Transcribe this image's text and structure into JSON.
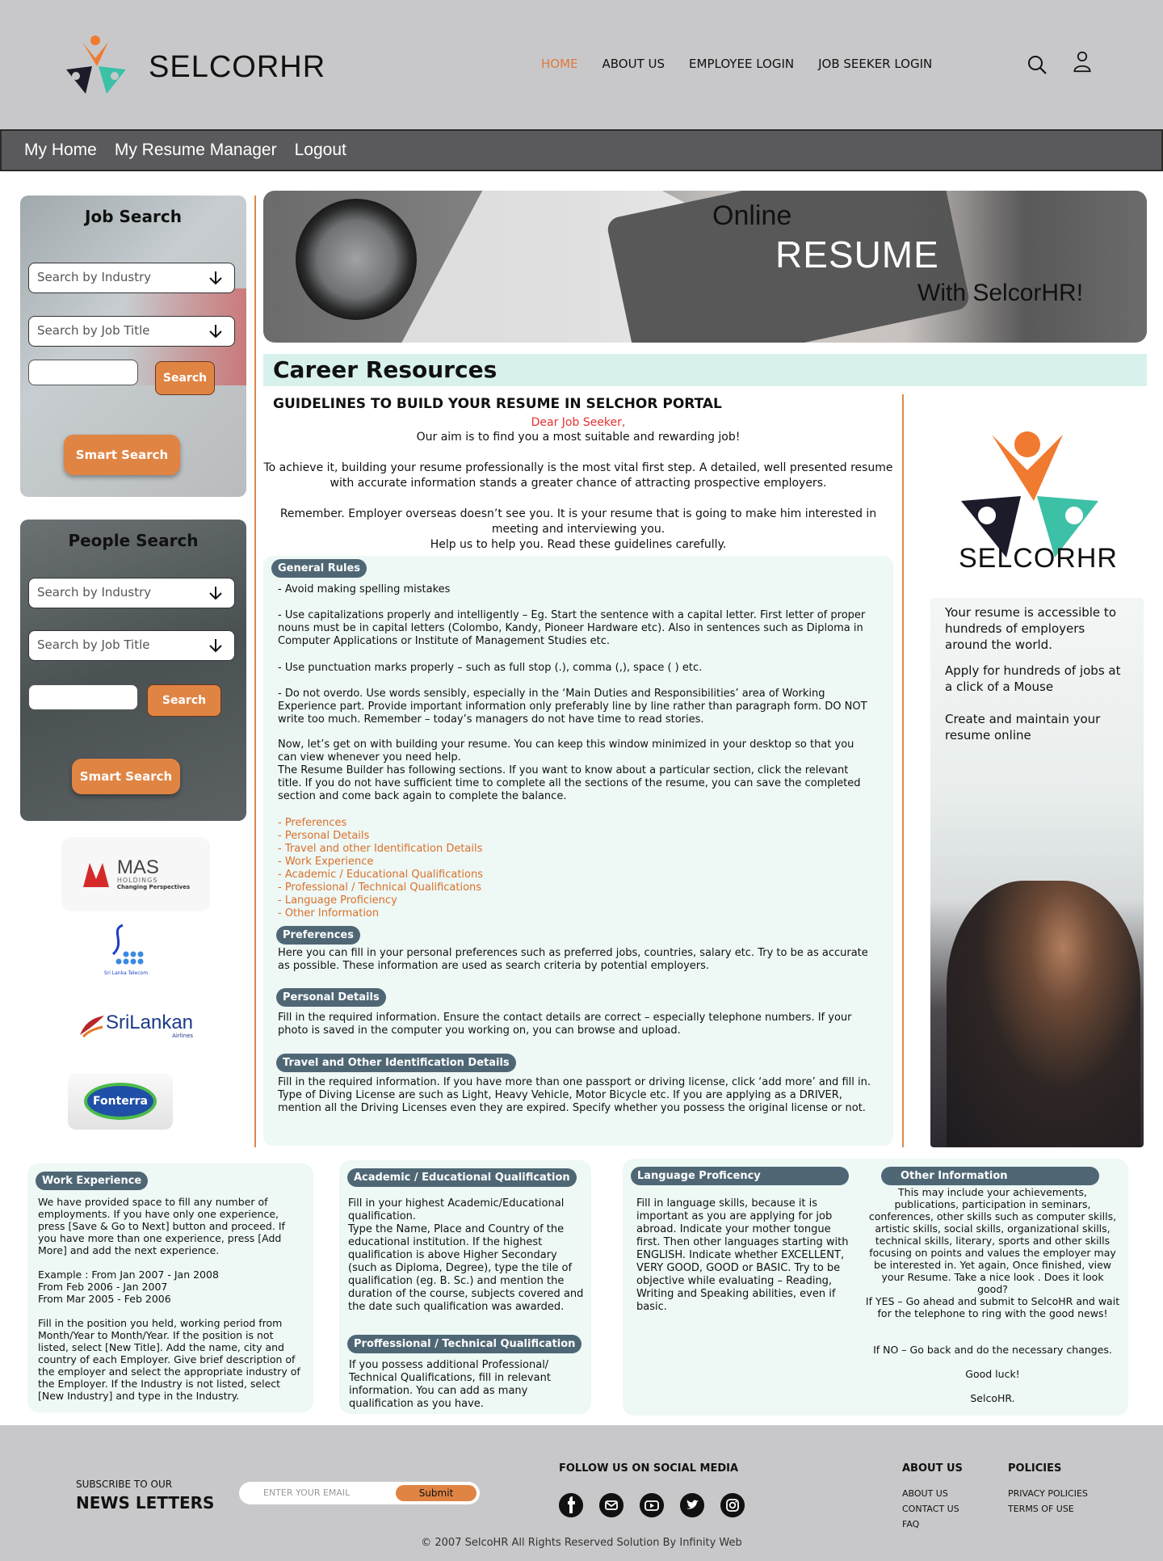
{
  "brand": "SELCORHR",
  "nav": {
    "home": "HOME",
    "about": "ABOUT US",
    "employee_login": "EMPLOYEE LOGIN",
    "job_seeker_login": "JOB SEEKER LOGIN"
  },
  "submenu": {
    "my_home": "My Home",
    "resume_manager": "My Resume Manager",
    "logout": "Logout"
  },
  "job_search": {
    "title": "Job Search",
    "industry": "Search by Industry",
    "job_title": "Search by Job Title",
    "keyword": "",
    "search": "Search",
    "smart": "Smart Search"
  },
  "people_search": {
    "title": "People Search",
    "industry": "Search by Industry",
    "job_title": "Search by Job Title",
    "keyword": "",
    "search": "Search",
    "smart": "Smart Search"
  },
  "clients": {
    "mas_name": "MAS",
    "mas_sub": "HOLDINGS",
    "mas_tag": "Changing Perspectives",
    "slt": "Sri Lanka Telecom",
    "srilankan": "SriLankan",
    "srilankan_sub": "Airlines",
    "fonterra": "Fonterra"
  },
  "banner": {
    "line1": "Online",
    "line2": "RESUME",
    "line3": "With SelcorHR!"
  },
  "career": {
    "title": "Career Resources",
    "heading": "GUIDELINES TO BUILD YOUR RESUME IN SELCHOR PORTAL",
    "dear": "Dear Job Seeker,",
    "aim": "Our aim is to find you a most suitable and rewarding job!",
    "p1a": "To achieve it, building your resume professionally is the most vital first step. A detailed, well presented resume",
    "p1b": "with accurate   information stands a greater chance of attracting prospective employers.",
    "p2a": "Remember. Employer overseas doesn’t see you. It is your resume that is going to make him interested in",
    "p2b": "meeting and interviewing you.",
    "p2c": "Help us to help you. Read these guidelines carefully."
  },
  "rules": {
    "general_label": "General Rules",
    "r1": "- Avoid making spelling mistakes",
    "r2": "- Use capitalizations properly and intelligently – Eg. Start the sentence with a capital letter. First letter of proper nouns must be in capital letters (Colombo, Kandy, Pioneer Hardware etc). Also in sentences such as Diploma in Computer Applications or Institute of Management Studies etc.",
    "r3": "- Use punctuation marks properly – such as full stop (.), comma (,), space ( ) etc.",
    "r4": "- Do not overdo. Use words sensibly, especially in the ‘Main Duties and Responsibilities’ area of Working Experience part. Provide important information only preferably line by line rather than paragraph form. DO NOT write too much. Remember – today’s managers do not have time to read stories.",
    "r5": "Now, let’s get on with building your resume. You can keep this window minimized in your desktop so that you can view whenever you need help.",
    "r6": "  The Resume Builder has following sections. If you want to know about a particular section, click the relevant title. If you do not have sufficient time to complete all the sections of the resume, you can save the completed section and come back again to complete the balance.",
    "sections": [
      "- Preferences",
      "- Personal Details",
      "- Travel and other Identification Details",
      "- Work Experience",
      "- Academic / Educational Qualifications",
      "- Professional / Technical Qualifications",
      "- Language Proficiency",
      "- Other Information"
    ],
    "pref_label": "Preferences",
    "pref_text": "Here you can fill in your personal preferences such as preferred jobs, countries, salary etc. Try to be as accurate as possible. These information are used as search criteria by potential employers.",
    "personal_label": "Personal Details",
    "personal_text": "Fill in the required information. Ensure the contact details are correct – especially telephone numbers. If your photo is saved in the computer you working on, you can browse and upload.",
    "travel_label": "Travel and Other Identification Details",
    "travel_text": "Fill in the required information. If you have more than one passport or driving license, click ‘add more’ and fill in. Type of Diving License are such as Light, Heavy Vehicle, Motor Bicycle etc. If you are applying as a DRIVER, mention all the Driving Licenses even they are expired. Specify whether you possess the original license or not."
  },
  "right_col": {
    "brand": "SELCORHR",
    "t1": "Your resume is accessible to hundreds of employers around the world.",
    "t2": "Apply for hundreds of jobs at a click of a Mouse",
    "t3": "Create and maintain your resume online"
  },
  "lower": {
    "work_label": "Work Experience",
    "work_p1": "We have provided space to fill any number of employments. If you have only one experience, press [Save & Go to Next] button and proceed. If you have more than one experience, press [Add More] and add the next experience.",
    "work_ex1": "Example : From Jan 2007 - Jan 2008",
    "work_ex2": "From Feb 2006 - Jan 2007",
    "work_ex3": "From Mar 2005 - Feb 2006",
    "work_p2": "Fill in the position you held, working period from Month/Year to Month/Year. If the position is not listed, select [New Title]. Add the name, city and country of each Employer. Give brief description of the employer and select the appropriate industry of the Employer. If the Industry is not listed, select [New Industry] and type in the Industry.",
    "acad_label": "Academic / Educational Qualification",
    "acad_p1": "Fill in your highest Academic/Educational qualification.",
    "acad_p2": " Type the Name, Place and Country of the educational institution. If the highest qualification is above Higher Secondary (such as Diploma, Degree), type the tile of qualification (eg. B. Sc.) and mention the duration of the course, subjects covered and the date such qualification was awarded.",
    "prof_label": "Proffessional / Technical Qualification",
    "prof_p": "If you possess additional Professional/ Technical Qualifications, fill in relevant information. You can add as many qualification as you have.",
    "lang_label": "Language Proficency",
    "lang_p": "Fill in language skills, because it is important as you are applying for job abroad. Indicate your mother tongue first. Then other languages starting with ENGLISH. Indicate whether EXCELLENT, VERY GOOD, GOOD or BASIC. Try to be objective while evaluating – Reading, Writing and Speaking abilities, even if basic.",
    "other_label": "Other Information",
    "other_p1": "This may include your achievements, publications, participation in seminars, conferences, other skills such as computer skills, artistic skills, social skills, organizational skills, technical skills, literary, sports and other skills focusing on points and values the employer may be interested in. Yet again, Once finished, view your Resume. Take a nice look . Does it look good?",
    "other_p2": "If YES – Go ahead and submit to SelcoHR and wait for the telephone to ring with the good news!",
    "other_p3": "If NO – Go back and do the necessary changes.",
    "other_luck": "Good luck!",
    "other_sign": "SelcoHR."
  },
  "footer": {
    "subscribe": "SUBSCRIBE TO OUR",
    "newsletters": "NEWS LETTERS",
    "email_placeholder": "ENTER YOUR EMAIL",
    "submit": "Submit",
    "follow": "FOLLOW US ON SOCIAL MEDIA",
    "about_h": "ABOUT US",
    "about_links": [
      "ABOUT US",
      "CONTACT US",
      "FAQ"
    ],
    "policies_h": "POLICIES",
    "policy_links": [
      "PRIVACY POLICIES",
      "TERMS OF  USE"
    ],
    "copyright": "© 2007 SelcoHR All Rights Reserved Solution By Infinity Web"
  },
  "colors": {
    "accent": "#e08444",
    "header_bg": "#c8c8ca",
    "pill_bg": "#4f6775",
    "mint": "#eef8f5"
  },
  "icons": [
    "search-icon",
    "user-icon",
    "arrow-down-icon",
    "facebook-icon",
    "email-icon",
    "youtube-icon",
    "twitter-icon",
    "instagram-icon"
  ]
}
